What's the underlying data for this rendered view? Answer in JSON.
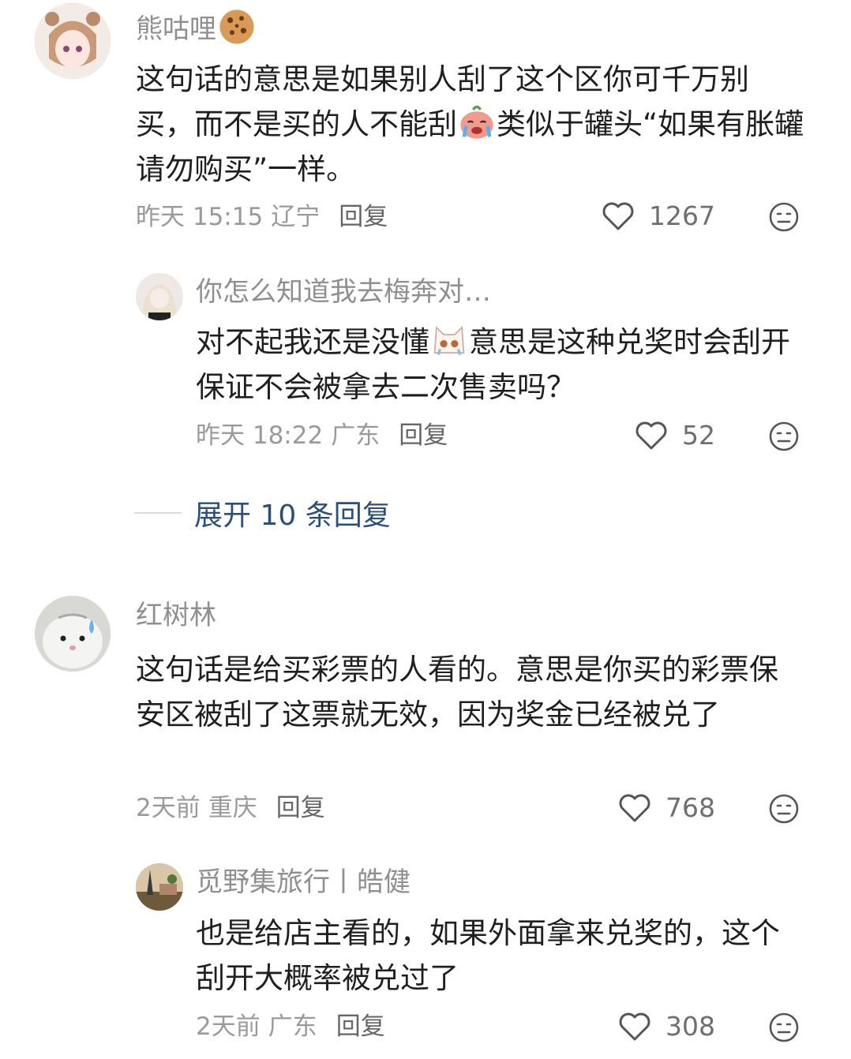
{
  "comments": [
    {
      "username": "熊咕哩",
      "username_emoji": "cookie-emoji",
      "text_a": "这句话的意思是如果别人刮了这个区你可千万别买，而不是买的人不能刮",
      "text_emoji": "crying-face-emoji",
      "text_b": "类似于罐头“如果有胀罐请勿购买”一样。",
      "time": "昨天 15:15",
      "location": "辽宁",
      "reply_label": "回复",
      "likes": "1267"
    },
    {
      "username": "你怎么知道我去梅奔对…",
      "text_a": "对不起我还是没懂",
      "text_emoji": "teary-cat-emoji",
      "text_b": "意思是这种兑奖时会刮开保证不会被拿去二次售卖吗？",
      "time": "昨天 18:22",
      "location": "广东",
      "reply_label": "回复",
      "likes": "52"
    },
    {
      "username": "红树林",
      "text": "这句话是给买彩票的人看的。意思是你买的彩票保安区被刮了这票就无效，因为奖金已经被兑了",
      "time": "2天前",
      "location": "重庆",
      "reply_label": "回复",
      "likes": "768"
    },
    {
      "username": "觅野集旅行丨皓健",
      "text": "也是给店主看的，如果外面拿来兑奖的，这个刮开大概率被兑过了",
      "time": "2天前",
      "location": "广东",
      "reply_label": "回复",
      "likes": "308"
    }
  ],
  "expand_replies": "展开 10 条回复",
  "colors": {
    "accent_link": "#2a4f7a",
    "meta_gray": "#9a9a9a",
    "username_gray": "#8f8f8f"
  }
}
